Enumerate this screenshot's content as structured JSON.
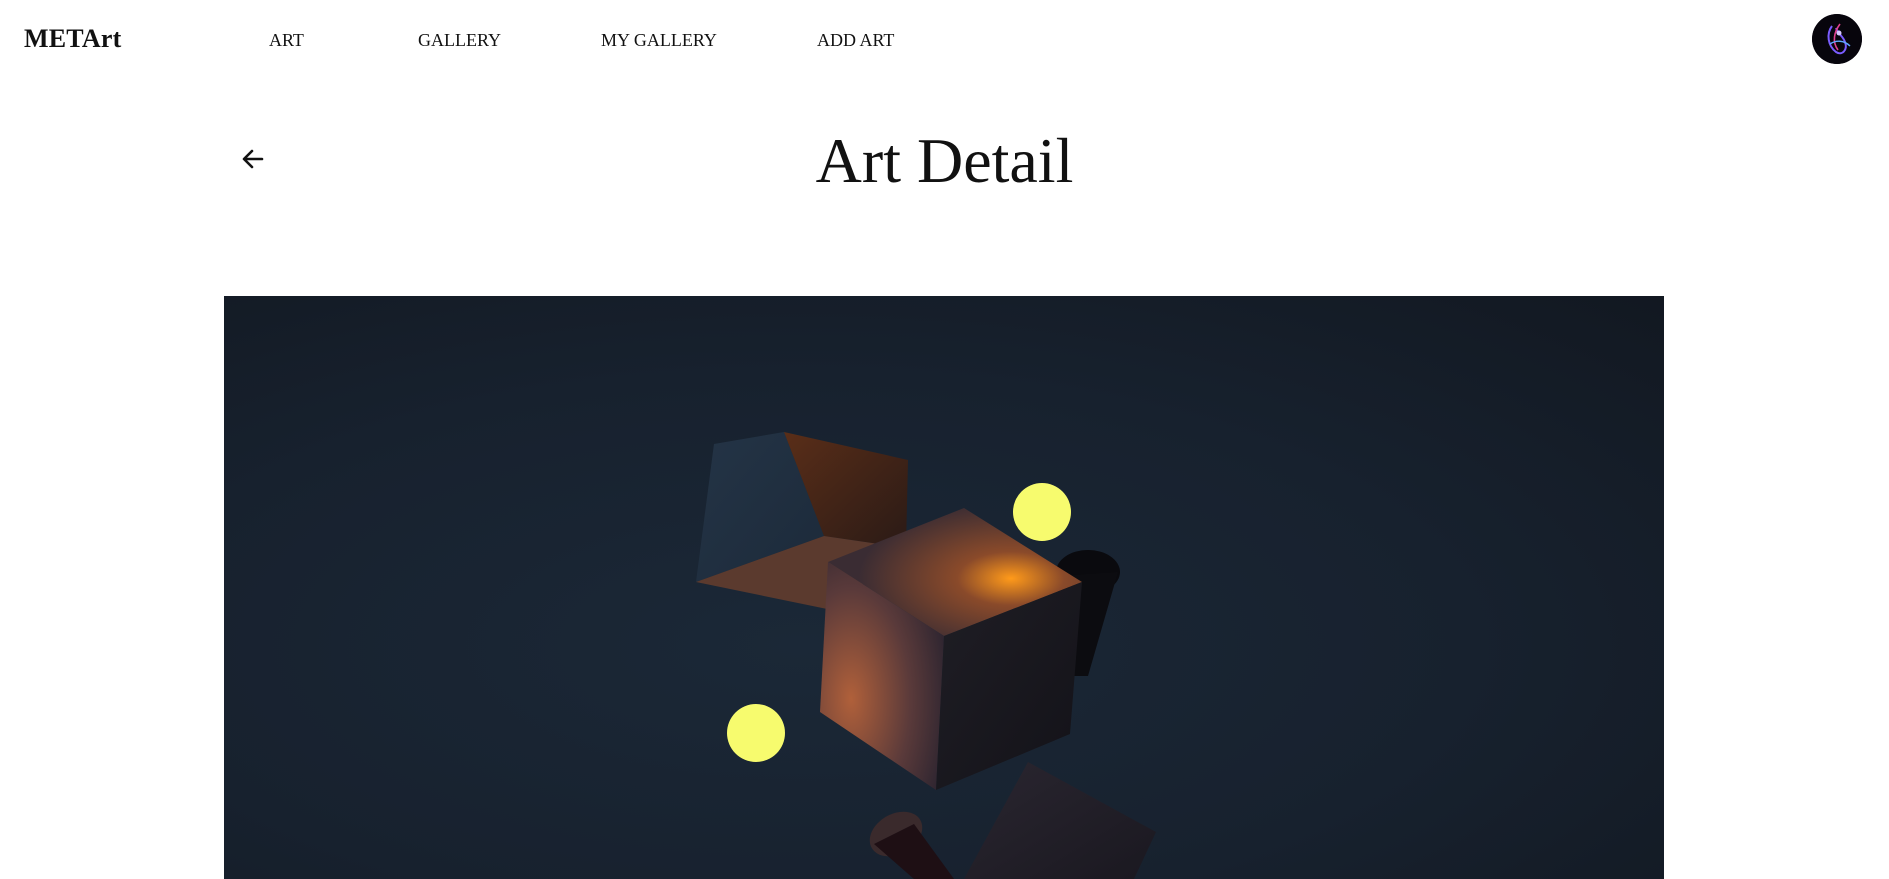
{
  "header": {
    "brand": "METArt",
    "nav": [
      {
        "label": "ART"
      },
      {
        "label": "GALLERY"
      },
      {
        "label": "MY GALLERY"
      },
      {
        "label": "ADD ART"
      }
    ],
    "avatar_icon": "user-avatar"
  },
  "page": {
    "title": "Art Detail",
    "back_icon": "arrow-left-icon"
  },
  "artwork": {
    "description_icon": "abstract-3d-cubes-artwork",
    "colors": {
      "background": "#17212e",
      "glow": "#f5a623",
      "sphere": "#f7fb6e"
    }
  }
}
